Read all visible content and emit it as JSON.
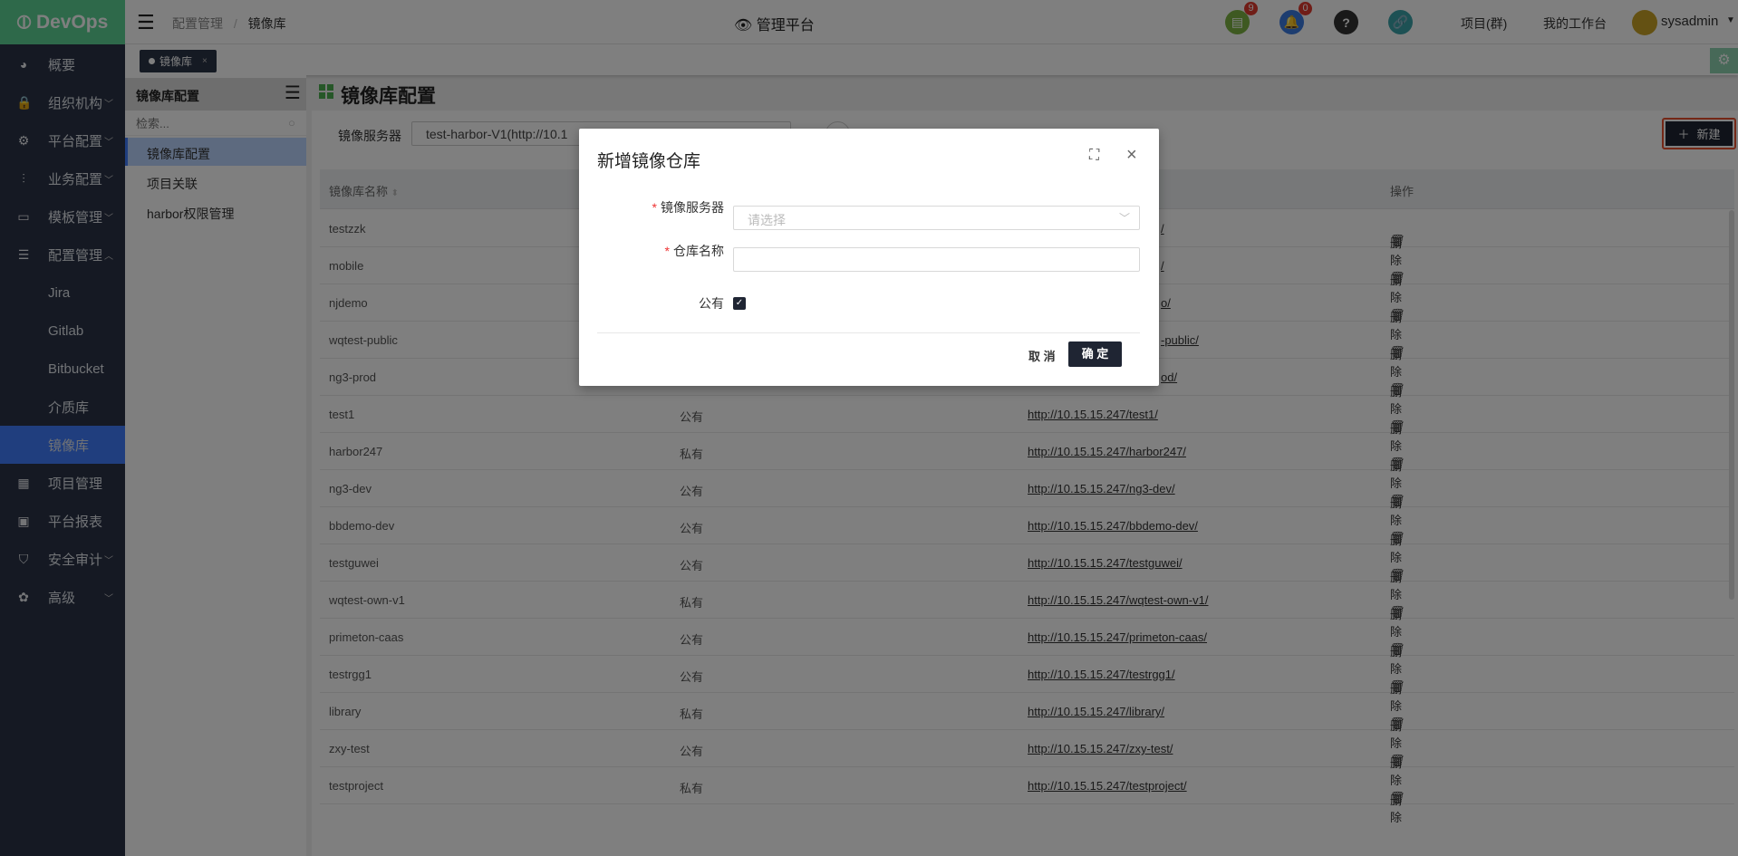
{
  "app": {
    "logo": "DevOps",
    "center_title": "管理平台"
  },
  "breadcrumb": [
    "配置管理",
    "镜像库"
  ],
  "header": {
    "badge_tasks": "9",
    "badge_notifications": "0",
    "projects": "项目(群)",
    "workbench": "我的工作台",
    "user": "sysadmin"
  },
  "sidebar": {
    "items": [
      {
        "label": "概要",
        "icon": "dashboard-icon",
        "chev": ""
      },
      {
        "label": "组织机构",
        "icon": "lock-icon",
        "chev": "﹀"
      },
      {
        "label": "平台配置",
        "icon": "gear-icon",
        "chev": "﹀"
      },
      {
        "label": "业务配置",
        "icon": "sliders-icon",
        "chev": "﹀"
      },
      {
        "label": "模板管理",
        "icon": "template-icon",
        "chev": "﹀"
      },
      {
        "label": "配置管理",
        "icon": "database-icon",
        "chev": "︿"
      },
      {
        "label": "Jira",
        "sub": true
      },
      {
        "label": "Gitlab",
        "sub": true
      },
      {
        "label": "Bitbucket",
        "sub": true
      },
      {
        "label": "介质库",
        "sub": true
      },
      {
        "label": "镜像库",
        "sub": true,
        "selected": true
      },
      {
        "label": "项目管理",
        "icon": "grid-icon",
        "chev": ""
      },
      {
        "label": "平台报表",
        "icon": "monitor-icon",
        "chev": ""
      },
      {
        "label": "安全审计",
        "icon": "shield-icon",
        "chev": "﹀"
      },
      {
        "label": "高级",
        "icon": "advanced-icon",
        "chev": "﹀"
      }
    ]
  },
  "tab": {
    "label": "镜像库",
    "close": "×"
  },
  "secondary": {
    "title": "镜像库配置",
    "search_placeholder": "检索...",
    "items": [
      "镜像库配置",
      "项目关联",
      "harbor权限管理"
    ]
  },
  "main": {
    "title": "镜像库配置",
    "filter_label": "镜像服务器",
    "filter_value": "test-harbor-V1(http://10.1",
    "new_button": "新建"
  },
  "table": {
    "headers": {
      "name": "镜像库名称",
      "op": "操作"
    },
    "delete_label": "删除",
    "rows": [
      {
        "name": "testzzk",
        "vis": "",
        "url": "/",
        "partial": true
      },
      {
        "name": "mobile",
        "vis": "",
        "url": "/",
        "partial": true
      },
      {
        "name": "njdemo",
        "vis": "",
        "url": "o/",
        "partial": true
      },
      {
        "name": "wqtest-public",
        "vis": "",
        "url": "-public/",
        "partial": true
      },
      {
        "name": "ng3-prod",
        "vis": "",
        "url": "od/",
        "partial": true
      },
      {
        "name": "test1",
        "vis": "公有",
        "url": "http://10.15.15.247/test1/"
      },
      {
        "name": "harbor247",
        "vis": "私有",
        "url": "http://10.15.15.247/harbor247/"
      },
      {
        "name": "ng3-dev",
        "vis": "公有",
        "url": "http://10.15.15.247/ng3-dev/"
      },
      {
        "name": "bbdemo-dev",
        "vis": "公有",
        "url": "http://10.15.15.247/bbdemo-dev/"
      },
      {
        "name": "testguwei",
        "vis": "公有",
        "url": "http://10.15.15.247/testguwei/"
      },
      {
        "name": "wqtest-own-v1",
        "vis": "私有",
        "url": "http://10.15.15.247/wqtest-own-v1/"
      },
      {
        "name": "primeton-caas",
        "vis": "公有",
        "url": "http://10.15.15.247/primeton-caas/"
      },
      {
        "name": "testrgg1",
        "vis": "公有",
        "url": "http://10.15.15.247/testrgg1/"
      },
      {
        "name": "library",
        "vis": "私有",
        "url": "http://10.15.15.247/library/"
      },
      {
        "name": "zxy-test",
        "vis": "公有",
        "url": "http://10.15.15.247/zxy-test/"
      },
      {
        "name": "testproject",
        "vis": "私有",
        "url": "http://10.15.15.247/testproject/"
      }
    ]
  },
  "modal": {
    "title": "新增镜像仓库",
    "server_label": "镜像服务器",
    "server_placeholder": "请选择",
    "name_label": "仓库名称",
    "name_value": "",
    "public_label": "公有",
    "public_checked": true,
    "cancel": "取 消",
    "ok": "确 定",
    "required_mark": "*"
  },
  "colors": {
    "accent": "#1f2533",
    "sidebar_selected": "#407cfc",
    "logo_bg": "#5cd394",
    "highlight": "#e8512f"
  }
}
